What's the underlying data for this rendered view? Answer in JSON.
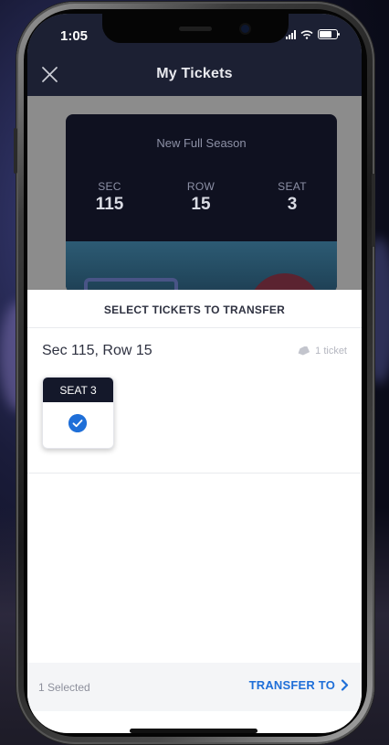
{
  "status_bar": {
    "time": "1:05"
  },
  "header": {
    "title": "My Tickets",
    "close_icon": "close-icon"
  },
  "ticket": {
    "event_name": "New Full Season",
    "columns": [
      {
        "label": "SEC",
        "value": "115"
      },
      {
        "label": "ROW",
        "value": "15"
      },
      {
        "label": "SEAT",
        "value": "3"
      }
    ]
  },
  "sheet": {
    "title": "SELECT TICKETS TO TRANSFER",
    "section": {
      "title": "Sec 115, Row 15",
      "count": "1 ticket",
      "count_icon": "ticket-tag-icon"
    },
    "seats": [
      {
        "label": "SEAT 3",
        "selected": true
      }
    ],
    "footer": {
      "selected_text": "1 Selected",
      "transfer_label": "TRANSFER TO",
      "transfer_icon": "chevron-right-icon"
    }
  },
  "colors": {
    "accent": "#1f6fd8",
    "header_bg": "#1c2033",
    "seat_header_bg": "#14182a"
  }
}
